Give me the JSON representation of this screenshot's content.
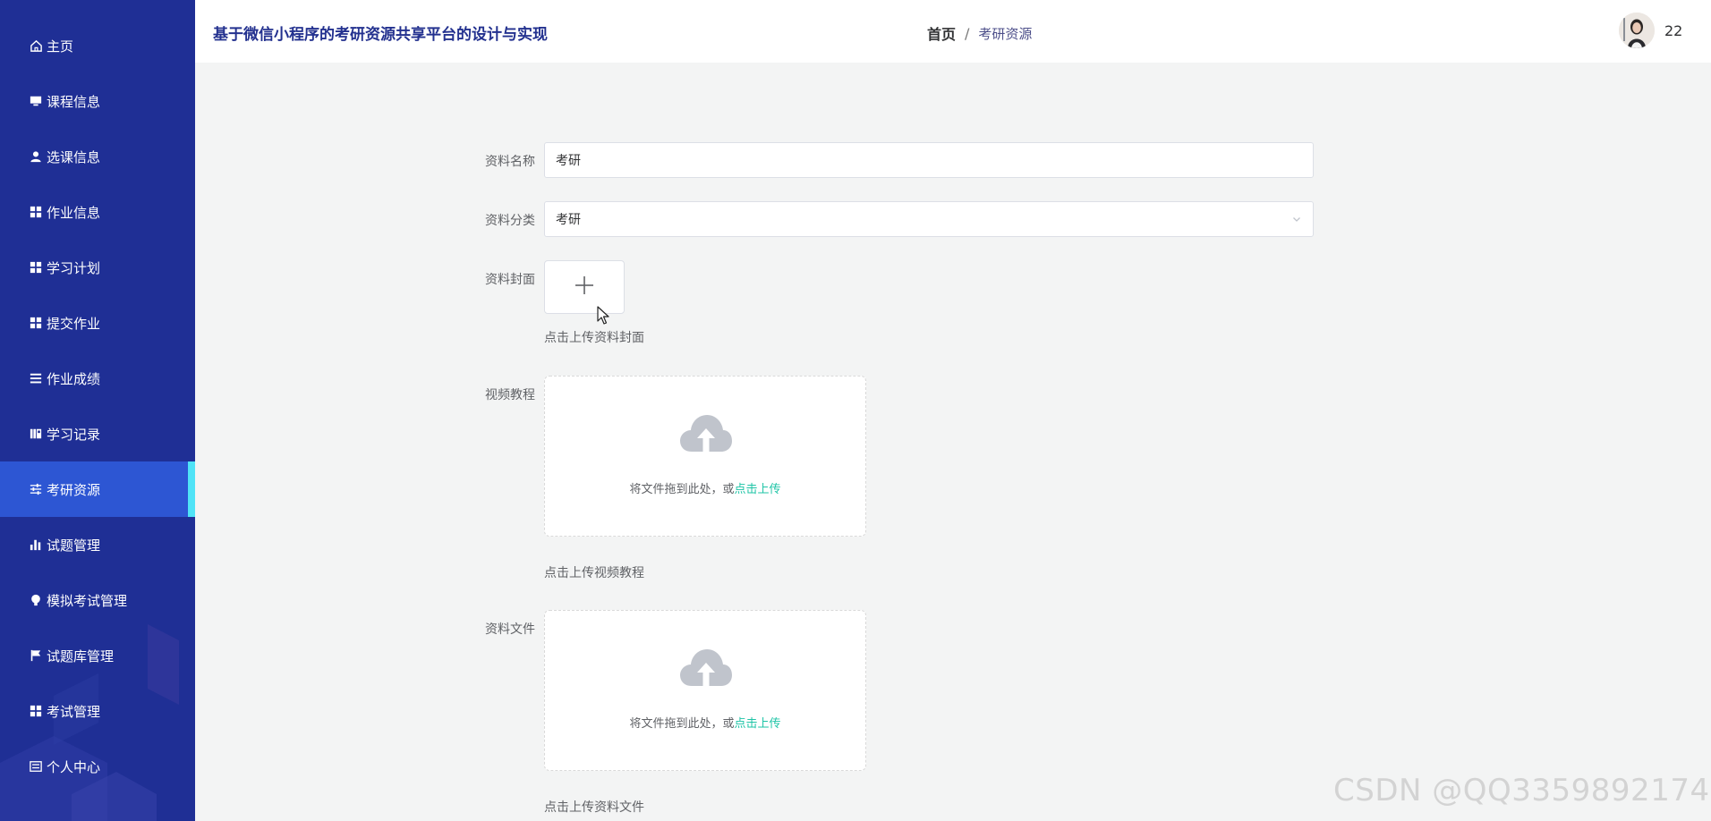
{
  "app": {
    "title": "基于微信小程序的考研资源共享平台的设计与实现"
  },
  "sidebar": {
    "items": [
      {
        "label": "主页",
        "icon": "home-icon"
      },
      {
        "label": "课程信息",
        "icon": "monitor-icon"
      },
      {
        "label": "选课信息",
        "icon": "user-icon"
      },
      {
        "label": "作业信息",
        "icon": "grid-icon"
      },
      {
        "label": "学习计划",
        "icon": "grid-icon"
      },
      {
        "label": "提交作业",
        "icon": "grid-icon"
      },
      {
        "label": "作业成绩",
        "icon": "list-icon"
      },
      {
        "label": "学习记录",
        "icon": "book-icon"
      },
      {
        "label": "考研资源",
        "icon": "sliders-icon",
        "active": true
      },
      {
        "label": "试题管理",
        "icon": "bar-chart-icon"
      },
      {
        "label": "模拟考试管理",
        "icon": "bulb-icon"
      },
      {
        "label": "试题库管理",
        "icon": "flag-icon"
      },
      {
        "label": "考试管理",
        "icon": "grid-icon"
      },
      {
        "label": "个人中心",
        "icon": "user-card-icon"
      }
    ]
  },
  "header": {
    "breadcrumb": {
      "home": "首页",
      "separator": "/",
      "current": "考研资源"
    },
    "username": "22"
  },
  "form": {
    "name": {
      "label": "资料名称",
      "value": "考研"
    },
    "category": {
      "label": "资料分类",
      "value": "考研"
    },
    "cover": {
      "label": "资料封面",
      "tip": "点击上传资料封面"
    },
    "video": {
      "label": "视频教程",
      "drag_text": "将文件拖到此处，或",
      "link_text": "点击上传",
      "tip": "点击上传视频教程"
    },
    "file": {
      "label": "资料文件",
      "drag_text": "将文件拖到此处，或",
      "link_text": "点击上传",
      "tip": "点击上传资料文件"
    }
  },
  "watermark": "CSDN @QQ3359892174",
  "colors": {
    "sidebar_bg": "#1f2f95",
    "sidebar_active": "#2d56d3",
    "active_indicator": "#4fe3f7",
    "title_color": "#23318f",
    "upload_link": "#1ec4a6",
    "page_bg": "#f3f4f4"
  }
}
